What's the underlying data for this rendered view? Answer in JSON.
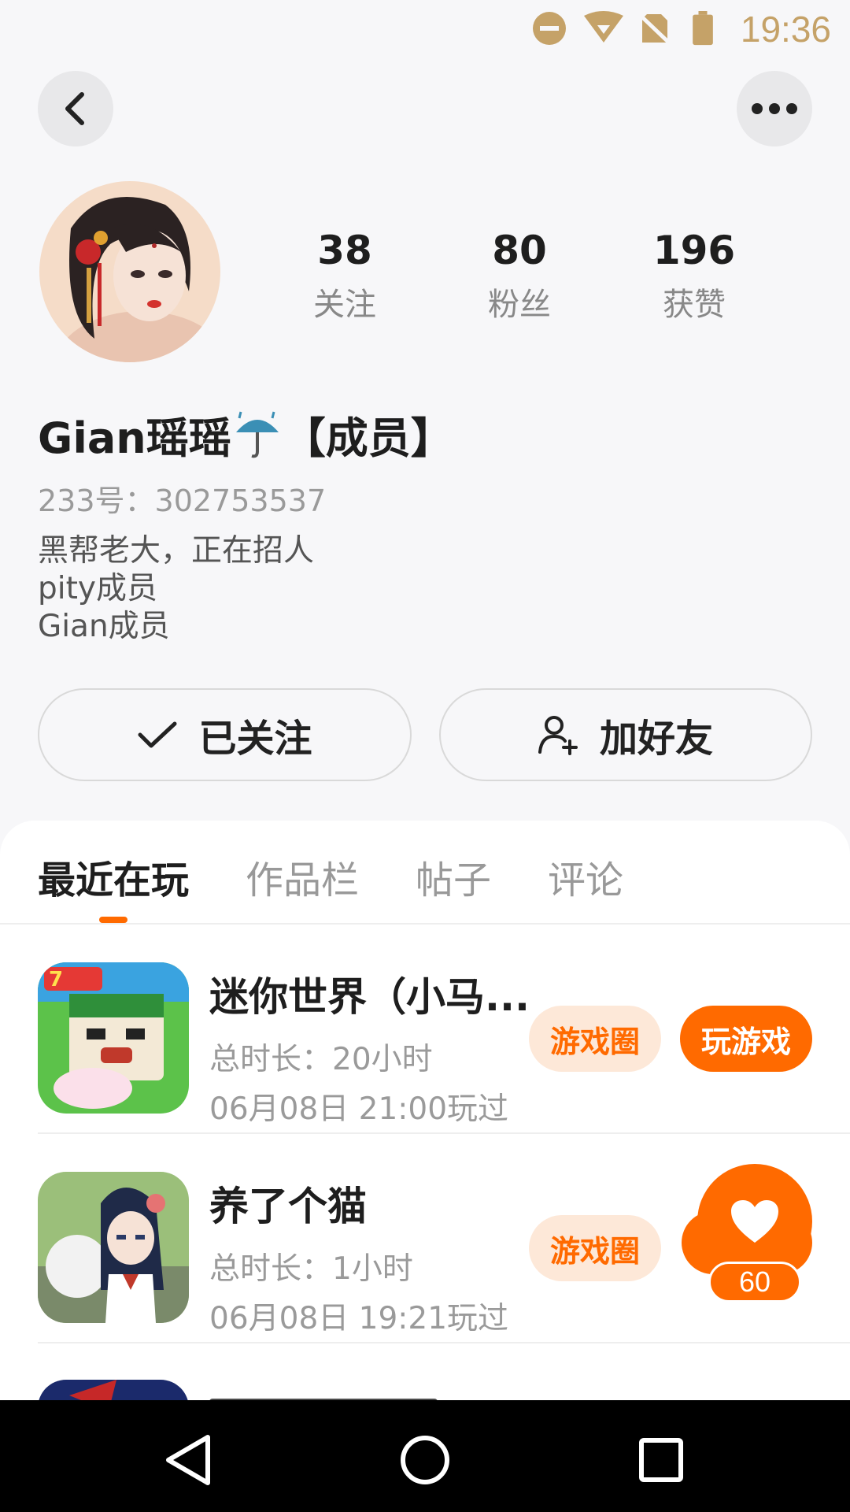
{
  "status_bar": {
    "time": "19:36",
    "icons": [
      "do-not-disturb-icon",
      "wifi-icon",
      "no-sim-icon",
      "battery-icon"
    ],
    "color": "#c5a268"
  },
  "header": {
    "back_icon": "chevron-left-icon",
    "more_icon": "more-horizontal-icon"
  },
  "profile": {
    "stats": [
      {
        "value": "38",
        "label": "关注"
      },
      {
        "value": "80",
        "label": "粉丝"
      },
      {
        "value": "196",
        "label": "获赞"
      }
    ],
    "nickname_prefix": "Gian瑶瑶",
    "nickname_suffix": "【成员】",
    "nickname_emoji": "umbrella-rain-icon",
    "uid": "233号：302753537",
    "bio": [
      "黑帮老大，正在招人",
      "pity成员",
      "Gian成员"
    ],
    "follow_button": "已关注",
    "add_friend_button": "加好友"
  },
  "tabs": [
    {
      "label": "最近在玩",
      "active": true
    },
    {
      "label": "作品栏",
      "active": false
    },
    {
      "label": "帖子",
      "active": false
    },
    {
      "label": "评论",
      "active": false
    }
  ],
  "games": [
    {
      "title": "迷你世界（小马...",
      "duration": "总时长：20小时",
      "last_played": "06月08日 21:00玩过",
      "circle_button": "游戏圈",
      "play_button": "玩游戏"
    },
    {
      "title": "养了个猫",
      "duration": "总时长：1小时",
      "last_played": "06月08日 19:21玩过",
      "circle_button": "游戏圈"
    }
  ],
  "like_float": {
    "count": "60"
  },
  "colors": {
    "accent": "#ff6a00",
    "accent_light": "#fde8d8",
    "background": "#f7f7f9"
  },
  "nav_bar": {
    "icons": [
      "back-triangle-icon",
      "home-circle-icon",
      "recents-square-icon"
    ]
  }
}
